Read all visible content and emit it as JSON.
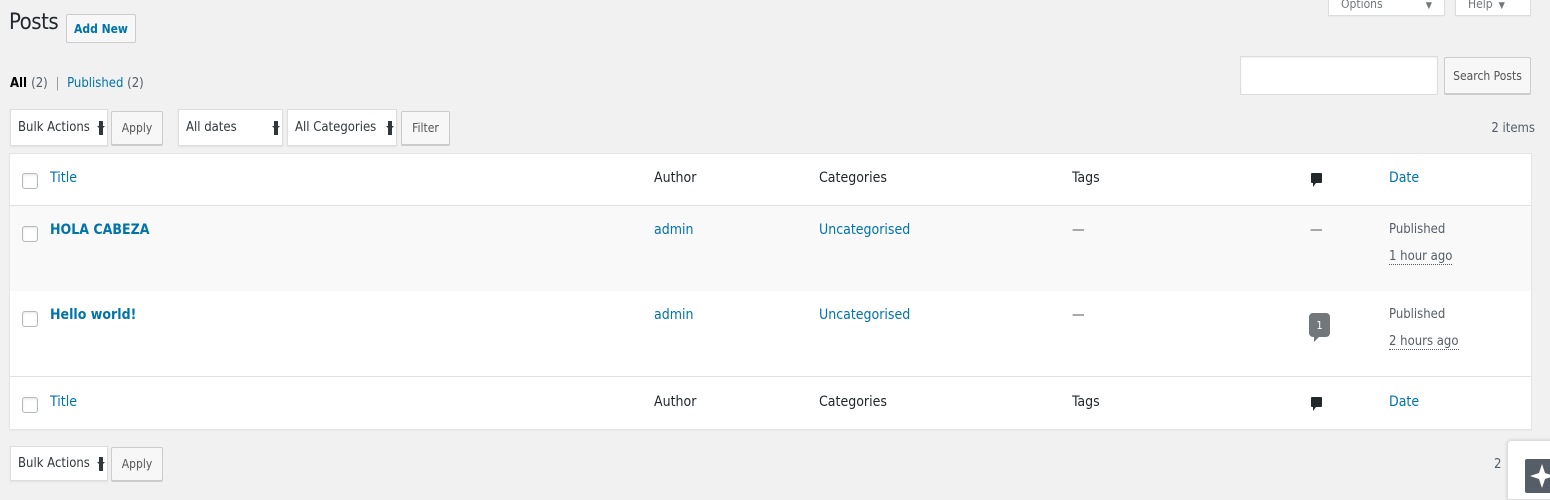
{
  "header": {
    "title": "Posts",
    "add_new": "Add New",
    "screen_options": "Screen Options",
    "help": "Help"
  },
  "views": {
    "all_label": "All",
    "all_count": "(2)",
    "separator": "|",
    "published_label": "Published",
    "published_count": "(2)"
  },
  "search": {
    "value": "",
    "button": "Search Posts"
  },
  "tablenav_top": {
    "bulk_actions": "Bulk Actions",
    "apply": "Apply",
    "dates": "All dates",
    "categories": "All Categories",
    "filter": "Filter",
    "items_count": "2 items"
  },
  "table": {
    "columns": {
      "title": "Title",
      "author": "Author",
      "categories": "Categories",
      "tags": "Tags",
      "comments_icon": "comment-icon",
      "date": "Date"
    },
    "rows": [
      {
        "title": "HOLA CABEZA",
        "author": "admin",
        "categories": "Uncategorised",
        "tags": "—",
        "comments": "—",
        "status": "Published",
        "time": "1 hour ago"
      },
      {
        "title": "Hello world!",
        "author": "admin",
        "categories": "Uncategorised",
        "tags": "—",
        "comments": "1",
        "status": "Published",
        "time": "2 hours ago"
      }
    ]
  },
  "tablenav_bottom": {
    "bulk_actions": "Bulk Actions",
    "apply": "Apply",
    "items_count_partial": "2"
  },
  "colors": {
    "link": "#0073aa",
    "background": "#f1f1f1",
    "text": "#23282d"
  }
}
